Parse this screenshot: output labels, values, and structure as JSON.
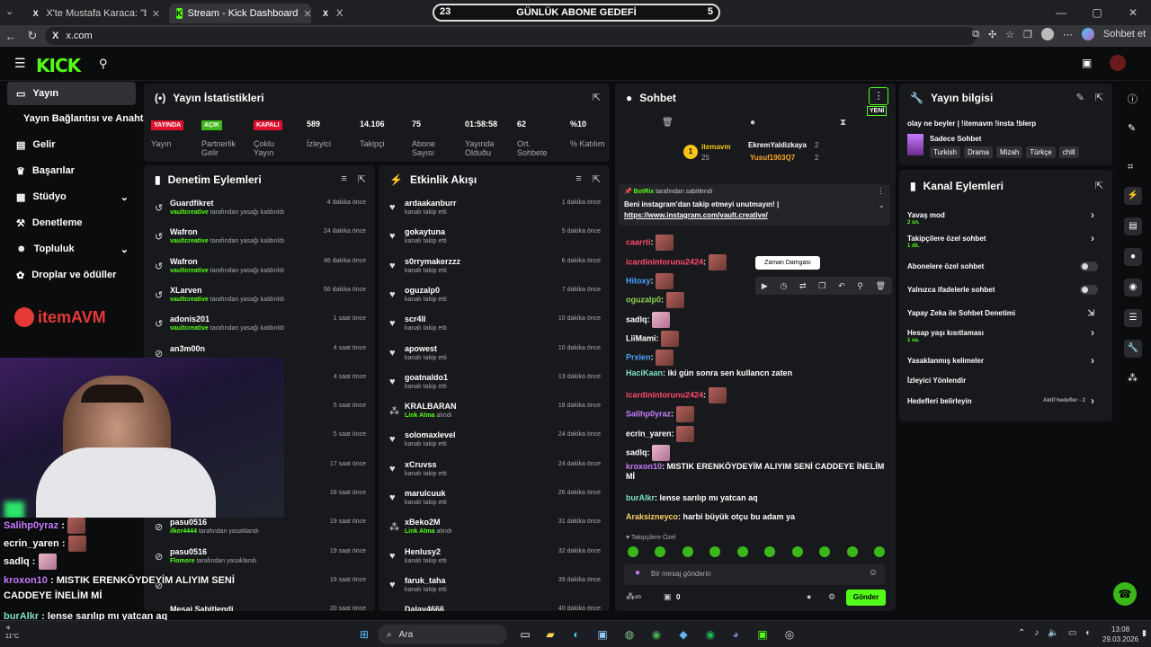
{
  "browser": {
    "tabs": [
      {
        "title": "X'te Mustafa Karaca: \"beyler elimd",
        "favicon": "X"
      },
      {
        "title": "Stream - Kick Dashboard",
        "favicon": "K"
      },
      {
        "title": "X",
        "favicon": "X"
      }
    ],
    "goal": {
      "label": "GÜNLÜK ABONE GEDEFİ",
      "left": "23",
      "right": "5"
    },
    "url": "x.com",
    "chat_button": "Sohbet et"
  },
  "sidebar": {
    "items": [
      {
        "label": "Yayın",
        "icon": "broadcast-icon"
      },
      {
        "label": "Yayın Bağlantısı ve Anahtarı",
        "icon": ""
      },
      {
        "label": "Gelir",
        "icon": "chart-icon"
      },
      {
        "label": "Başarılar",
        "icon": "trophy-icon"
      },
      {
        "label": "Stüdyo",
        "icon": "studio-icon"
      },
      {
        "label": "Denetleme",
        "icon": "hammer-icon"
      },
      {
        "label": "Topluluk",
        "icon": "community-icon"
      },
      {
        "label": "Droplar ve ödüller",
        "icon": "gift-icon"
      }
    ],
    "sponsor": "itemAVM"
  },
  "stats": {
    "title": "Yayın İstatistikleri",
    "items": [
      {
        "value": "YAYINDA",
        "label": "Yayın",
        "type": "badge-red"
      },
      {
        "value": "AÇIK",
        "label": "Partnerlik Gelir",
        "type": "badge-green"
      },
      {
        "value": "KAPALI",
        "label": "Çoklu Yayın",
        "type": "badge-red"
      },
      {
        "value": "589",
        "label": "İzleyici"
      },
      {
        "value": "14.106",
        "label": "Takipçi"
      },
      {
        "value": "75",
        "label": "Abone Sayısı"
      },
      {
        "value": "01:58:58",
        "label": "Yayında Olduğu Süre"
      },
      {
        "value": "62",
        "label": "Ort. Sohbete Katılım"
      },
      {
        "value": "%10",
        "label": "% Katılım"
      }
    ]
  },
  "moderation": {
    "title": "Denetim Eylemleri",
    "rows": [
      {
        "name": "Guardfikret",
        "by": "vaultcreative",
        "action": "tarafından yasağı kaldırıldı",
        "time": "4 dakika önce"
      },
      {
        "name": "Wafron",
        "by": "vaultcreative",
        "action": "tarafından yasağı kaldırıldı",
        "time": "24 dakika önce"
      },
      {
        "name": "Wafron",
        "by": "vaultcreative",
        "action": "tarafından yasağı kaldırıldı",
        "time": "46 dakika önce"
      },
      {
        "name": "XLarven",
        "by": "vaultcreative",
        "action": "tarafından yasağı kaldırıldı",
        "time": "56 dakika önce"
      },
      {
        "name": "adonis201",
        "by": "vaultcreative",
        "action": "tarafından yasağı kaldırıldı",
        "time": "1 saat önce"
      },
      {
        "name": "an3m00n",
        "by": "",
        "action": "",
        "time": "4 saat önce"
      },
      {
        "name": "",
        "by": "",
        "action": "dı",
        "time": "4 saat önce"
      },
      {
        "name": "",
        "by": "",
        "action": "",
        "time": "5 saat önce"
      },
      {
        "name": "",
        "by": "",
        "action": "",
        "time": "5 saat önce"
      },
      {
        "name": "",
        "by": "",
        "action": "",
        "time": "17 saat önce"
      },
      {
        "name": "",
        "by": "",
        "action": "",
        "time": "18 saat önce"
      },
      {
        "name": "pasu0516",
        "by": "ilker4444",
        "action": "tarafından yasaklandı",
        "time": "19 saat önce"
      },
      {
        "name": "pasu0516",
        "by": "Flomore",
        "action": "tarafından yasaklandı",
        "time": "19 saat önce"
      },
      {
        "name": "",
        "by": "",
        "action": "",
        "time": "19 saat önce"
      },
      {
        "name": "Mesaj Sabitlendi",
        "by": "",
        "action": "",
        "time": "20 saat önce"
      }
    ]
  },
  "activity": {
    "title": "Etkinlik Akışı",
    "rows": [
      {
        "name": "ardaakanburr",
        "sub": "kanalı takip etti",
        "time": "1 dakika önce",
        "icon": "heart"
      },
      {
        "name": "gokaytuna",
        "sub": "kanalı takip etti",
        "time": "5 dakika önce",
        "icon": "heart"
      },
      {
        "name": "s0rrymakerzzz",
        "sub": "kanalı takip etti",
        "time": "6 dakika önce",
        "icon": "heart"
      },
      {
        "name": "oguzalp0",
        "sub": "kanalı takip etti",
        "time": "7 dakika önce",
        "icon": "heart"
      },
      {
        "name": "scr4ll",
        "sub": "kanalı takip etti",
        "time": "10 dakika önce",
        "icon": "heart"
      },
      {
        "name": "apowest",
        "sub": "kanalı takip etti",
        "time": "10 dakika önce",
        "icon": "heart"
      },
      {
        "name": "goatnaldo1",
        "sub": "kanalı takip etti",
        "time": "13 dakika önce",
        "icon": "heart"
      },
      {
        "name": "KRALBARAN",
        "sub": "Link Atma",
        "sub2": "alındı",
        "time": "18 dakika önce",
        "icon": "redeem"
      },
      {
        "name": "solomaxlevel",
        "sub": "kanalı takip etti",
        "time": "24 dakika önce",
        "icon": "heart"
      },
      {
        "name": "xCruvss",
        "sub": "kanalı takip etti",
        "time": "24 dakika önce",
        "icon": "heart"
      },
      {
        "name": "marulcuuk",
        "sub": "kanalı takip etti",
        "time": "26 dakika önce",
        "icon": "heart"
      },
      {
        "name": "xBeko2M",
        "sub": "Link Atma",
        "sub2": "alındı",
        "time": "31 dakika önce",
        "icon": "redeem"
      },
      {
        "name": "Henlusy2",
        "sub": "kanalı takip etti",
        "time": "32 dakika önce",
        "icon": "heart"
      },
      {
        "name": "faruk_taha",
        "sub": "kanalı takip etti",
        "time": "39 dakika önce",
        "icon": "heart"
      },
      {
        "name": "Dalay4666",
        "sub": "",
        "time": "40 dakika önce",
        "icon": "heart"
      }
    ]
  },
  "chat": {
    "title": "Sohbet",
    "new_label": "YENİ",
    "leaders": {
      "top": "itemavm",
      "top_count": "25",
      "u1": "EkremYaldizkaya",
      "u1c": "2",
      "u2": "Yusuf1903Q7",
      "u2c": "2"
    },
    "pinned": {
      "by": "BotRix",
      "by_suffix": "tarafından sabitlendi",
      "text": "Beni instagram'dan takip etmeyi unutmayın! |",
      "link": "https://www.instagram.com/vault.creative/"
    },
    "tooltip": "Zaman Damgası",
    "messages": [
      {
        "user": "caarrti",
        "color": "#ff4b6e",
        "text": "",
        "emote": "red"
      },
      {
        "user": "icardinintorunu2424",
        "color": "#ff4b6e",
        "text": "",
        "emote": "red"
      },
      {
        "user": "Hitoxy",
        "color": "#4aa3ff",
        "text": "",
        "emote": "red"
      },
      {
        "user": "oguzalp0",
        "color": "#8fd14f",
        "text": "",
        "emote": "red"
      },
      {
        "user": "sadlq",
        "color": "#ffffff",
        "text": "",
        "emote": "pink"
      },
      {
        "user": "LiiMami",
        "color": "#ffffff",
        "text": "",
        "emote": "red"
      },
      {
        "user": "Prxien",
        "color": "#4aa3ff",
        "text": "",
        "emote": "red"
      },
      {
        "user": "HaciKaan",
        "color": "#7fe3c8",
        "text": "iki gün sonra sen kullancn zaten"
      },
      {
        "user": "icardinintorunu2424",
        "color": "#ff4b6e",
        "text": "",
        "emote": "red"
      },
      {
        "user": "Salihp0yraz",
        "color": "#c77dff",
        "text": "",
        "emote": "red"
      },
      {
        "user": "ecrin_yaren",
        "color": "#ffffff",
        "text": "",
        "emote": "red"
      },
      {
        "user": "sadlq",
        "color": "#ffffff",
        "text": "",
        "emote": "pink"
      },
      {
        "user": "kroxon10",
        "color": "#c77dff",
        "text": "MISTIK ERENKÖYDEYİM ALIYIM SENİ CADDEYE İNELİM Mİ"
      },
      {
        "user": "burAlkr",
        "color": "#7fe3c8",
        "text": "lense sarılıp mı yatcan aq"
      },
      {
        "user": "Araksizneyco",
        "color": "#ffd166",
        "text": "harbi büyük otçu bu adam ya"
      }
    ],
    "followers_only": "Takipçilere Özel",
    "input_placeholder": "Bir mesaj gönderin",
    "counter": "0",
    "send": "Gönder"
  },
  "stream_info": {
    "title": "Yayın bilgisi",
    "stream_title": "olay ne beyler | !itemavm !insta !blerp",
    "category": "Sadece Sohbet",
    "tags": [
      "Turkish",
      "Drama",
      "Mizah",
      "Türkçe",
      "chill"
    ]
  },
  "channel_actions": {
    "title": "Kanal Eylemleri",
    "items": [
      {
        "label": "Yavaş mod",
        "sub": "2 sn.",
        "control": "chevron"
      },
      {
        "label": "Takipçilere özel sohbet",
        "sub": "1 dk.",
        "control": "chevron"
      },
      {
        "label": "Abonelere özel sohbet",
        "sub": "",
        "control": "toggle"
      },
      {
        "label": "Yalnızca ifadelerle sohbet",
        "sub": "",
        "control": "toggle"
      },
      {
        "label": "Yapay Zeka ile Sohbet Denetimi",
        "sub": "",
        "control": "external"
      },
      {
        "label": "Hesap yaşı kısıtlaması",
        "sub": "1 sa.",
        "control": "chevron"
      },
      {
        "label": "Yasaklanmış kelimeler",
        "sub": "",
        "control": "chevron"
      },
      {
        "label": "İzleyici Yönlendir",
        "sub": "",
        "control": "none"
      },
      {
        "label": "Hedefleri belirleyin",
        "sub": "",
        "control": "chevron",
        "extra": "Aktif hedefler - 2"
      }
    ]
  },
  "overlay_chat": [
    {
      "user": "Salihp0yraz",
      "color": "#c77dff",
      "text": ""
    },
    {
      "user": "ecrin_yaren",
      "color": "#ffffff",
      "text": ""
    },
    {
      "user": "sadlq",
      "color": "#ffffff",
      "text": ""
    },
    {
      "user": "kroxon10",
      "color": "#c77dff",
      "text": "MISTIK ERENKÖYDEYİM ALIYIM SENİ CADDEYE İNELİM Mİ"
    },
    {
      "user": "burAlkr",
      "color": "#7fe3c8",
      "text": "lense sarılıp mı yatcan aq"
    },
    {
      "user": "zneyco",
      "color": "#ffd166",
      "text": "harbi büyük otçu bu adam ya"
    }
  ],
  "taskbar": {
    "search": "Ara",
    "weather": "11°C",
    "time": "13:08",
    "date": "29.03.2026"
  }
}
